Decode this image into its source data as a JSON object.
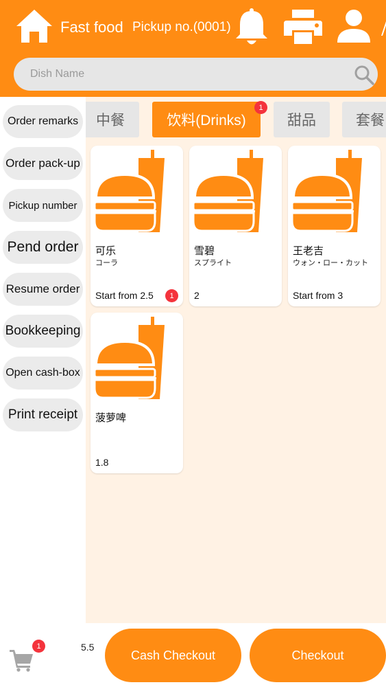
{
  "colors": {
    "accent": "#FF8C13",
    "badge": "#F4333C",
    "panel": "#FFF2E4",
    "pill_gray": "#EBEBEB"
  },
  "header": {
    "title": "Fast food",
    "pickup": "Pickup no.(0001)",
    "icons": [
      "home-icon",
      "bell-icon",
      "printer-icon",
      "user-icon"
    ]
  },
  "search": {
    "placeholder": "Dish Name",
    "value": ""
  },
  "sidebar": {
    "items": [
      {
        "label": "Order remarks"
      },
      {
        "label": "Order pack-up"
      },
      {
        "label": "Pickup number"
      },
      {
        "label": "Pend order"
      },
      {
        "label": "Resume order"
      },
      {
        "label": "Bookkeeping"
      },
      {
        "label": "Open cash-box"
      },
      {
        "label": "Print receipt"
      }
    ]
  },
  "categories": {
    "tabs": [
      {
        "label": "中餐",
        "active": false
      },
      {
        "label": "饮料(Drinks)",
        "active": true,
        "badge": "1"
      },
      {
        "label": "甜品",
        "active": false
      },
      {
        "label": "套餐",
        "active": false
      }
    ]
  },
  "products": [
    {
      "name": "可乐",
      "subtitle": "コーラ",
      "price": "Start from 2.5",
      "badge": "1",
      "icon": "burger-drink-icon"
    },
    {
      "name": "雪碧",
      "subtitle": "スプライト",
      "price": "2",
      "icon": "burger-drink-icon"
    },
    {
      "name": "王老吉",
      "subtitle": "ウォン・ロー・カット",
      "price": "Start from 3",
      "icon": "burger-drink-icon"
    },
    {
      "name": "菠萝啤",
      "subtitle": "",
      "price": "1.8",
      "icon": "burger-drink-icon"
    }
  ],
  "footer": {
    "cart_badge": "1",
    "total": "5.5",
    "cash_checkout_label": "Cash Checkout",
    "checkout_label": "Checkout"
  }
}
